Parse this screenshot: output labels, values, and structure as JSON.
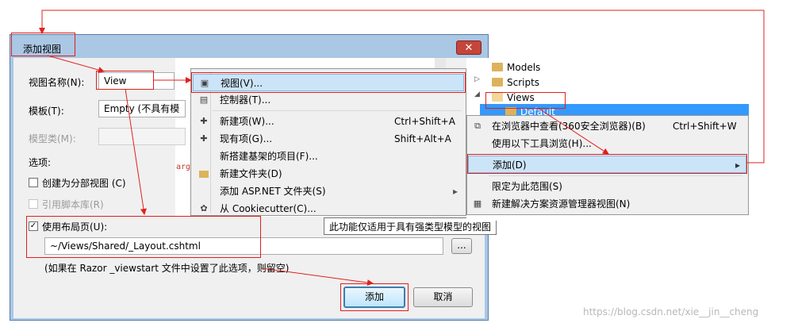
{
  "dialog": {
    "title": "添加视图",
    "close": "✕",
    "view_name_label": "视图名称(N):",
    "view_name_value": "View",
    "template_label": "模板(T):",
    "template_value": "Empty (不具有模",
    "model_class_label": "模型类(M):",
    "options_label": "选项:",
    "partial_view_label": "创建为分部视图 (C)",
    "script_lib_label": "引用脚本库(R)",
    "use_layout_label": "使用布局页(U):",
    "use_layout_checked": "✓",
    "layout_path": "~/Views/Shared/_Layout.cshtml",
    "browse": "...",
    "hint": "(如果在 Razor _viewstart 文件中设置了此选项，则留空)",
    "add_button": "添加",
    "cancel_button": "取消"
  },
  "editor": {
    "fragment": "arge"
  },
  "add_menu": {
    "items": [
      {
        "icon": "view-icon",
        "label": "视图(V)...",
        "shortcut": ""
      },
      {
        "icon": "controller-icon",
        "label": "控制器(T)...",
        "shortcut": ""
      },
      {
        "icon": "new-item-icon",
        "label": "新建项(W)...",
        "shortcut": "Ctrl+Shift+A"
      },
      {
        "icon": "existing-item-icon",
        "label": "现有项(G)...",
        "shortcut": "Shift+Alt+A"
      },
      {
        "icon": "",
        "label": "新搭建基架的项目(F)...",
        "shortcut": ""
      },
      {
        "icon": "new-folder-icon",
        "label": "新建文件夹(D)",
        "shortcut": ""
      },
      {
        "icon": "",
        "label": "添加 ASP.NET 文件夹(S)",
        "shortcut": "",
        "submenu": "▸"
      },
      {
        "icon": "cookiecutter-icon",
        "label": "从 Cookiecutter(C)...",
        "shortcut": ""
      }
    ]
  },
  "tooltip": "此功能仅适用于具有强类型模型的视图",
  "explorer": {
    "items": [
      {
        "label": "Models"
      },
      {
        "label": "Scripts"
      },
      {
        "label": "Views"
      },
      {
        "label": "Default"
      }
    ]
  },
  "folder_menu": {
    "items": [
      {
        "label": "在浏览器中查看(360安全浏览器)(B)",
        "shortcut": "Ctrl+Shift+W"
      },
      {
        "label": "使用以下工具浏览(H)...",
        "shortcut": ""
      },
      {
        "label": "添加(D)",
        "shortcut": "",
        "submenu": "▸"
      },
      {
        "label": "限定为此范围(S)",
        "shortcut": ""
      },
      {
        "label": "新建解决方案资源管理器视图(N)",
        "shortcut": ""
      }
    ]
  },
  "watermark": "https://blog.csdn.net/xie__jin__cheng",
  "colors": {
    "annotation": "#e0201d",
    "selection": "#cce4f7",
    "tree_selection": "#3399ff",
    "dialog_frame": "#aac7e4"
  }
}
